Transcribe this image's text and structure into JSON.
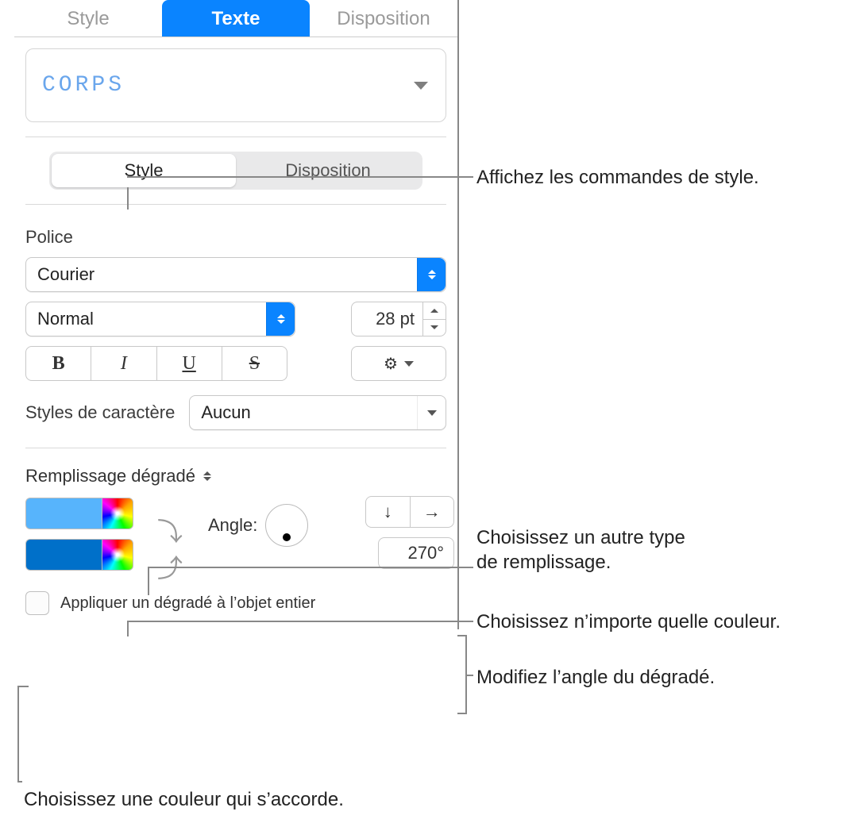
{
  "tabs": {
    "style": "Style",
    "text": "Texte",
    "layout": "Disposition"
  },
  "paragraph_style": "CORPS",
  "segmented": {
    "style": "Style",
    "layout": "Disposition"
  },
  "font": {
    "label": "Police",
    "family": "Courier",
    "weight": "Normal",
    "size": "28 pt",
    "buttons": {
      "bold": "B",
      "italic": "I",
      "underline": "U",
      "strike": "S"
    }
  },
  "char_styles": {
    "label": "Styles de caractère",
    "value": "Aucun"
  },
  "fill": {
    "type": "Remplissage dégradé",
    "angle_label": "Angle:",
    "angle_value": "270°",
    "dir_down": "↓",
    "dir_right": "→",
    "swap": "⤹⤴"
  },
  "apply_whole": "Appliquer un dégradé à l’objet entier",
  "callouts": {
    "style_cmds": "Affichez les commandes de style.",
    "fill_type": "Choisissez un autre type de remplissage.",
    "fill_type2": "",
    "any_color": "Choisissez n’importe quelle couleur.",
    "angle": "Modifiez l’angle du dégradé.",
    "matching_color": "Choisissez une couleur qui s’accorde."
  },
  "callout_fill_type_line1": "Choisissez un autre type",
  "callout_fill_type_line2": "de remplissage."
}
